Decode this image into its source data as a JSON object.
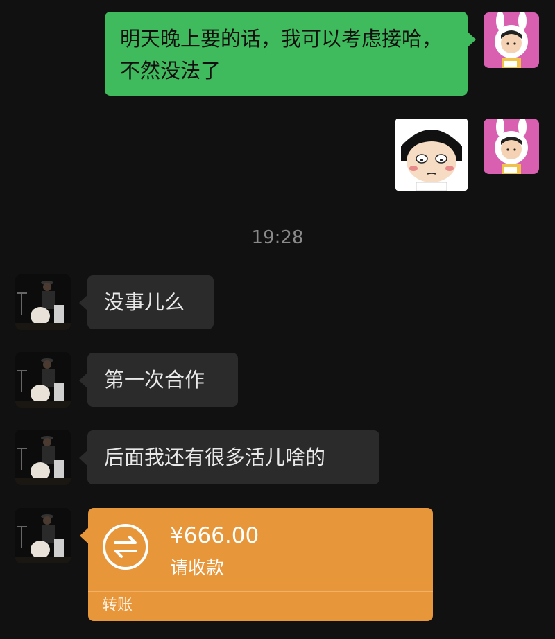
{
  "messages": {
    "sent_text": "明天晚上要的话，我可以考虑接哈，不然没法了",
    "timestamp": "19:28",
    "received_1": "没事儿么",
    "received_2": "第一次合作",
    "received_3": "后面我还有很多活儿啥的",
    "transfer": {
      "amount": "¥666.00",
      "note": "请收款",
      "label": "转账"
    }
  },
  "colors": {
    "sent_bubble": "#3fba5c",
    "received_bubble": "#2b2b2b",
    "transfer_card": "#e8963a",
    "background": "#111111"
  },
  "icons": {
    "transfer": "transfer-arrows-icon"
  }
}
